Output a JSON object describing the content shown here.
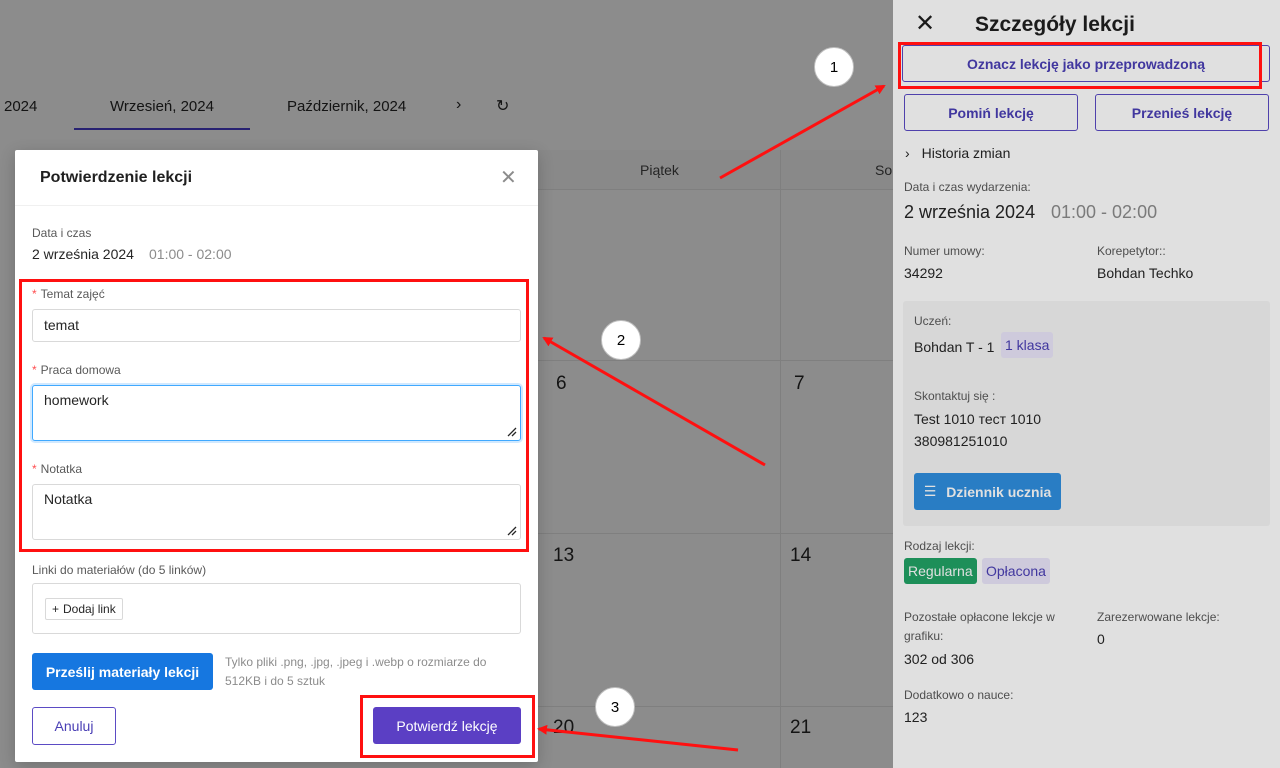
{
  "calendar": {
    "months": [
      "2024",
      "Wrzesień, 2024",
      "Październik, 2024"
    ],
    "day_headers": [
      "Piątek",
      "So"
    ],
    "day_numbers": [
      "6",
      "7",
      "13",
      "14",
      "20",
      "21"
    ]
  },
  "drawer": {
    "title": "Szczegóły lekcji",
    "mark_done_label": "Oznacz lekcję jako przeprowadzoną",
    "skip_label": "Pomiń lekcję",
    "move_label": "Przenieś lekcję",
    "history_label": "Historia zmian",
    "datetime_label": "Data i czas wydarzenia:",
    "date": "2 września 2024",
    "time": "01:00 - 02:00",
    "contract_label": "Numer umowy:",
    "contract": "34292",
    "tutor_label": "Korepetytor::",
    "tutor": "Bohdan Techko",
    "student_label": "Uczeń:",
    "student": "Bohdan T - 1",
    "student_class": "1 klasa",
    "contact_label": "Skontaktuj się :",
    "contact_name": "Test 1010 тест 1010",
    "contact_phone": "380981251010",
    "journal_label": "Dziennik ucznia",
    "lesson_type_label": "Rodzaj lekcji:",
    "type_tags": [
      "Regularna",
      "Opłacona"
    ],
    "remaining_label": "Pozostałe opłacone lekcje w grafiku:",
    "remaining": "302 od 306",
    "reserved_label": "Zarezerwowane lekcje:",
    "reserved": "0",
    "extra_label": "Dodatkowo o nauce:",
    "extra": "123"
  },
  "modal": {
    "title": "Potwierdzenie lekcji",
    "datetime_label": "Data i czas",
    "date": "2 września 2024",
    "time": "01:00 - 02:00",
    "topic_label": "Temat zajęć",
    "topic_value": "temat",
    "homework_label": "Praca domowa",
    "homework_value": "homework",
    "note_label": "Notatka",
    "note_value": "Notatka",
    "links_label": "Linki do materiałów (do 5 linków)",
    "add_link_label": "Dodaj link",
    "upload_label": "Prześlij materiały lekcji",
    "upload_hint": "Tylko pliki .png, .jpg, .jpeg i .webp o rozmiarze do 512KB i do 5 sztuk",
    "cancel_label": "Anuluj",
    "confirm_label": "Potwierdź lekcję"
  },
  "annotations": {
    "step_labels": [
      "1",
      "2",
      "3"
    ],
    "highlight_color": "#ff1010"
  }
}
